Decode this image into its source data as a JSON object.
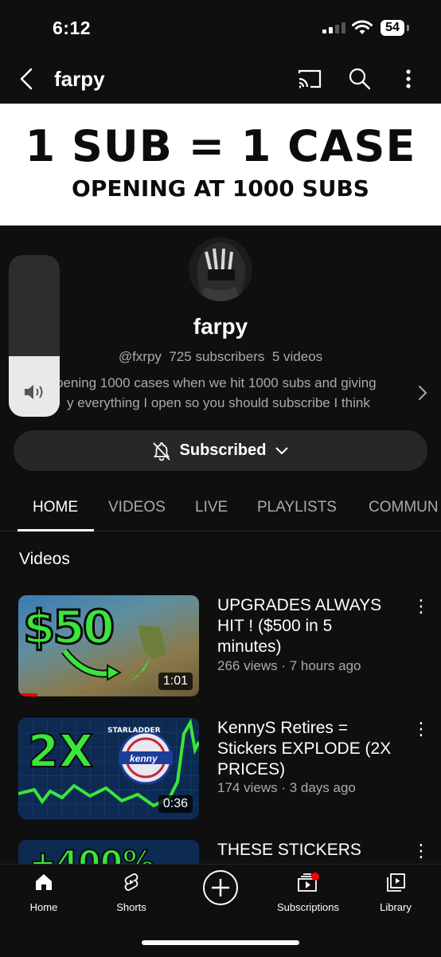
{
  "status_bar": {
    "time": "6:12",
    "battery": "54"
  },
  "header": {
    "title": "farpy",
    "icons": [
      "back-icon",
      "cast-icon",
      "search-icon",
      "more-vert-icon"
    ]
  },
  "banner": {
    "line1": "1 SUB = 1 CASE",
    "line2": "OPENING AT 1000 SUBS"
  },
  "channel": {
    "name": "farpy",
    "handle": "@fxrpy",
    "subscribers": "725 subscribers",
    "videos_count": "5 videos",
    "description_line1": "pening 1000 cases when we hit 1000 subs and giving",
    "description_line2": "y everything I open so you should subscribe I think"
  },
  "subscribe": {
    "label": "Subscribed"
  },
  "tabs": [
    "HOME",
    "VIDEOS",
    "LIVE",
    "PLAYLISTS",
    "COMMUN"
  ],
  "section": {
    "title": "Videos"
  },
  "videos": [
    {
      "title": "UPGRADES ALWAYS HIT ! ($500 in 5 minutes)",
      "meta": "266 views · 7 hours ago",
      "duration": "1:01",
      "thumb_text": "$50"
    },
    {
      "title": "KennyS Retires = Stickers EXPLODE (2X PRICES)",
      "meta": "174 views · 3 days ago",
      "duration": "0:36",
      "thumb_text": "2X",
      "thumb_badge": "kenny"
    },
    {
      "title": "THESE STICKERS",
      "meta": "",
      "duration": "",
      "thumb_text": "+400%"
    }
  ],
  "nav": [
    {
      "label": "Home",
      "icon": "home-icon"
    },
    {
      "label": "Shorts",
      "icon": "shorts-icon"
    },
    {
      "label": "",
      "icon": "create-icon"
    },
    {
      "label": "Subscriptions",
      "icon": "subscriptions-icon"
    },
    {
      "label": "Library",
      "icon": "library-icon"
    }
  ],
  "colors": {
    "background": "#0f0f0f",
    "accent_green": "#39e639",
    "notification_red": "#ff0000"
  }
}
